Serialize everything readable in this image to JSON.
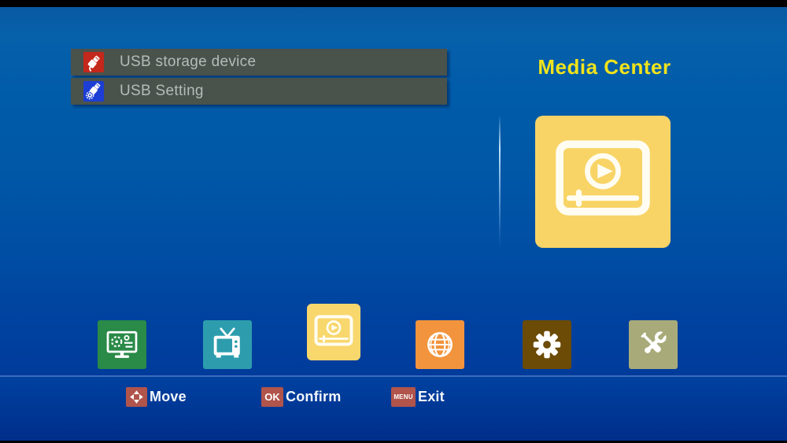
{
  "header": {
    "title": "Media Center"
  },
  "menu": {
    "items": [
      {
        "label": "USB storage device",
        "icon": "usb-storage-icon",
        "icon_color": "#c4271b"
      },
      {
        "label": "USB Setting",
        "icon": "usb-setting-icon",
        "icon_color": "#1c3ed4"
      }
    ]
  },
  "preview": {
    "icon": "media-player-icon",
    "tile_color": "#f8d466"
  },
  "bottom_nav": {
    "selected": "media-center",
    "items": [
      {
        "id": "system",
        "icon": "monitor-settings-icon",
        "tile_color": "#2a8a48",
        "selected": false
      },
      {
        "id": "tv",
        "icon": "tv-icon",
        "tile_color": "#2d9dad",
        "selected": false
      },
      {
        "id": "media-center",
        "icon": "media-player-icon",
        "tile_color": "#f8d76d",
        "selected": true
      },
      {
        "id": "network",
        "icon": "globe-icon",
        "tile_color": "#f2943d",
        "selected": false
      },
      {
        "id": "settings",
        "icon": "gear-icon",
        "tile_color": "#6b4b06",
        "selected": false
      },
      {
        "id": "tools",
        "icon": "tools-icon",
        "tile_color": "#a8ab79",
        "selected": false
      }
    ]
  },
  "hints": {
    "move": {
      "badge_icon": "dpad-arrows-icon",
      "label": "Move"
    },
    "confirm": {
      "badge_label": "OK",
      "label": "Confirm"
    },
    "exit": {
      "badge_label": "MENU",
      "label": "Exit"
    }
  },
  "colors": {
    "background_top": "#0a58a2",
    "background_bottom": "#003392",
    "menu_bar": "#4a524c",
    "menu_text": "#b5bcb8",
    "title_text": "#f0e31c",
    "hint_badge": "#b0544c",
    "selected_tile": "#f8d76d",
    "divider": "#3b6cbe"
  }
}
